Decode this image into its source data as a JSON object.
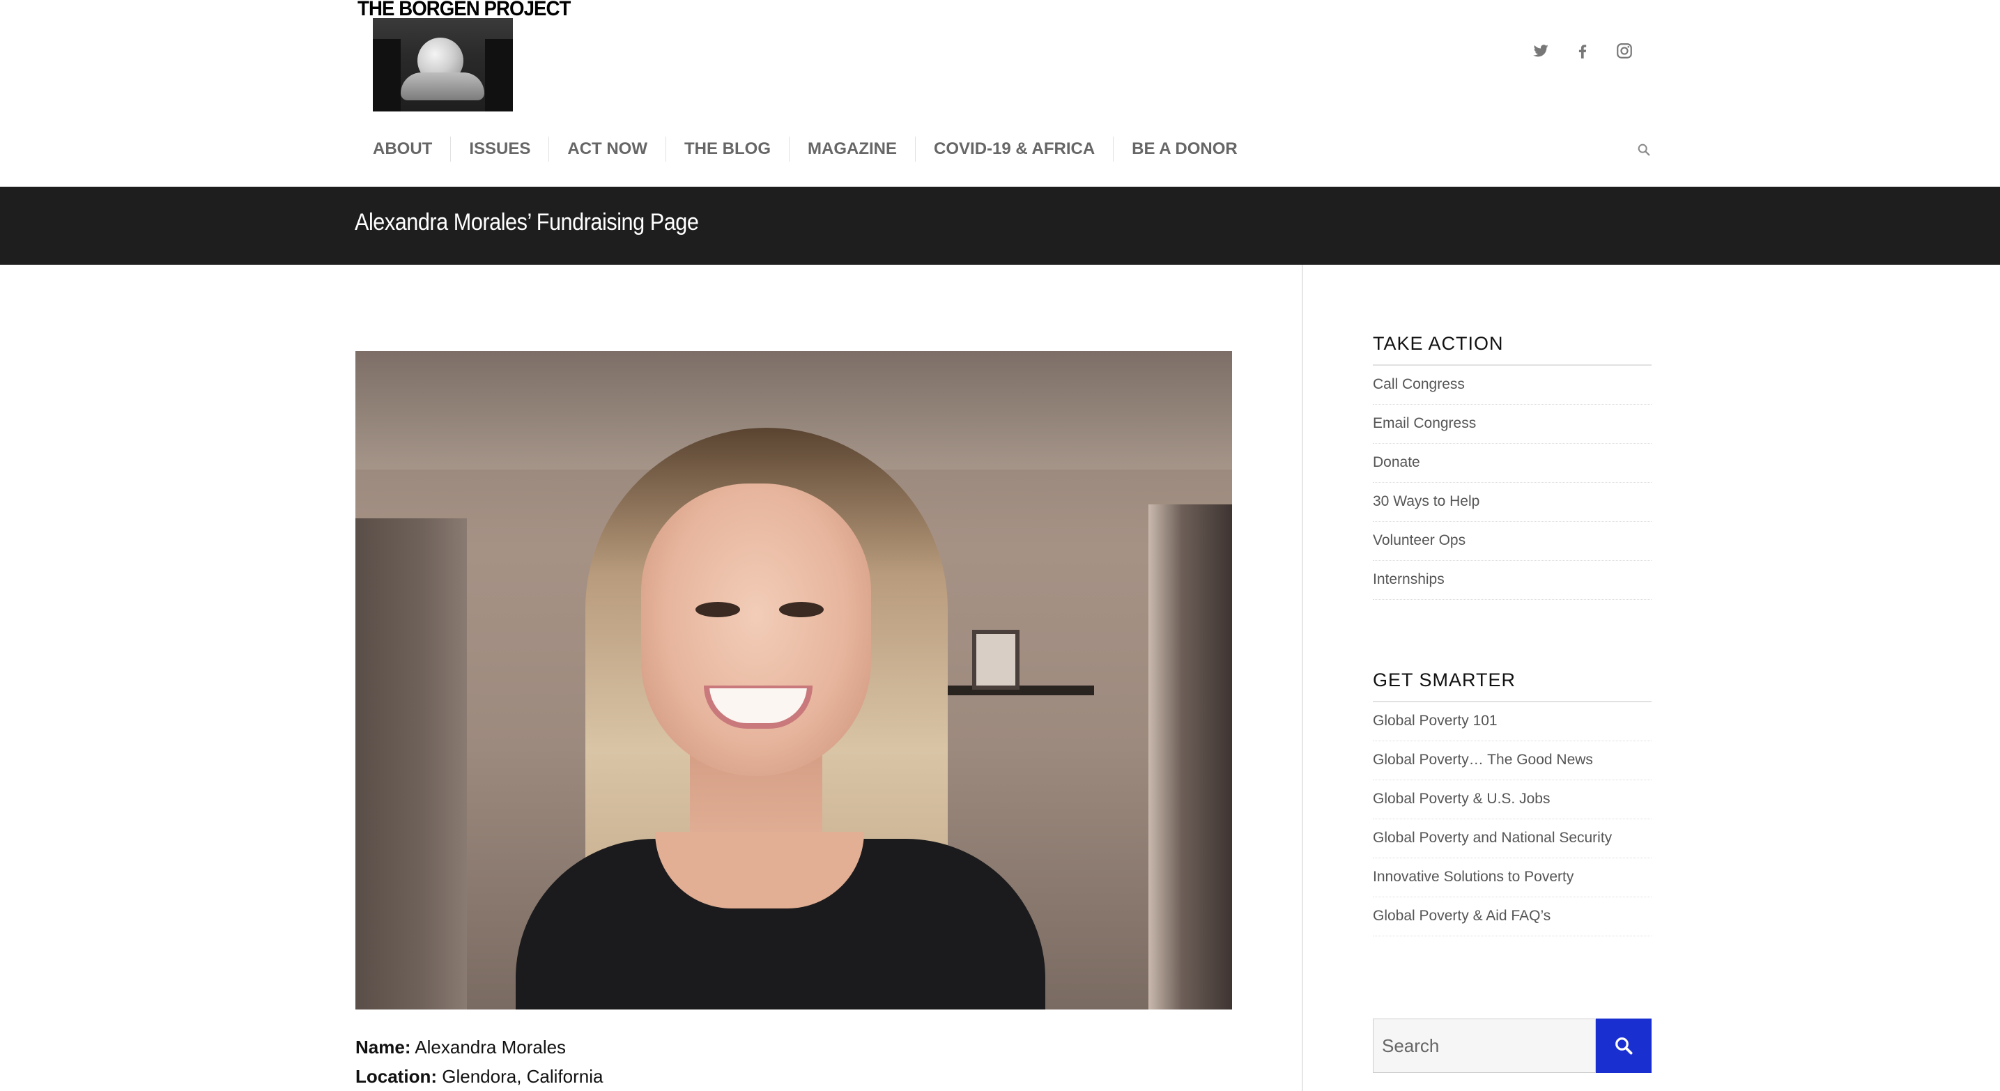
{
  "header": {
    "logo_text": "THE BORGEN PROJECT",
    "social": [
      {
        "icon": "twitter-icon"
      },
      {
        "icon": "facebook-icon"
      },
      {
        "icon": "instagram-icon"
      }
    ],
    "nav": [
      {
        "label": "ABOUT"
      },
      {
        "label": "ISSUES"
      },
      {
        "label": "ACT NOW"
      },
      {
        "label": "THE BLOG"
      },
      {
        "label": "MAGAZINE"
      },
      {
        "label": "COVID-19 & AFRICA"
      },
      {
        "label": "BE A DONOR"
      }
    ],
    "search_icon": "search-icon"
  },
  "title_bar": {
    "title": "Alexandra Morales’ Fundraising Page"
  },
  "main": {
    "details": [
      {
        "label": "Name:",
        "value": "Alexandra Morales"
      },
      {
        "label": "Location:",
        "value": "Glendora, California"
      }
    ]
  },
  "sidebar": {
    "widgets": [
      {
        "title": "TAKE ACTION",
        "items": [
          "Call Congress",
          "Email Congress",
          "Donate",
          "30 Ways to Help",
          "Volunteer Ops",
          "Internships"
        ]
      },
      {
        "title": "GET SMARTER",
        "items": [
          "Global Poverty 101",
          "Global Poverty… The Good News",
          "Global Poverty & U.S. Jobs",
          "Global Poverty and National Security",
          "Innovative Solutions to Poverty",
          "Global Poverty & Aid FAQ’s"
        ]
      }
    ],
    "search": {
      "placeholder": "Search",
      "button_icon": "search-icon"
    }
  },
  "colors": {
    "title_bar_bg": "#1e1e1e",
    "search_button_bg": "#1a2fd0",
    "nav_text": "#666666"
  }
}
